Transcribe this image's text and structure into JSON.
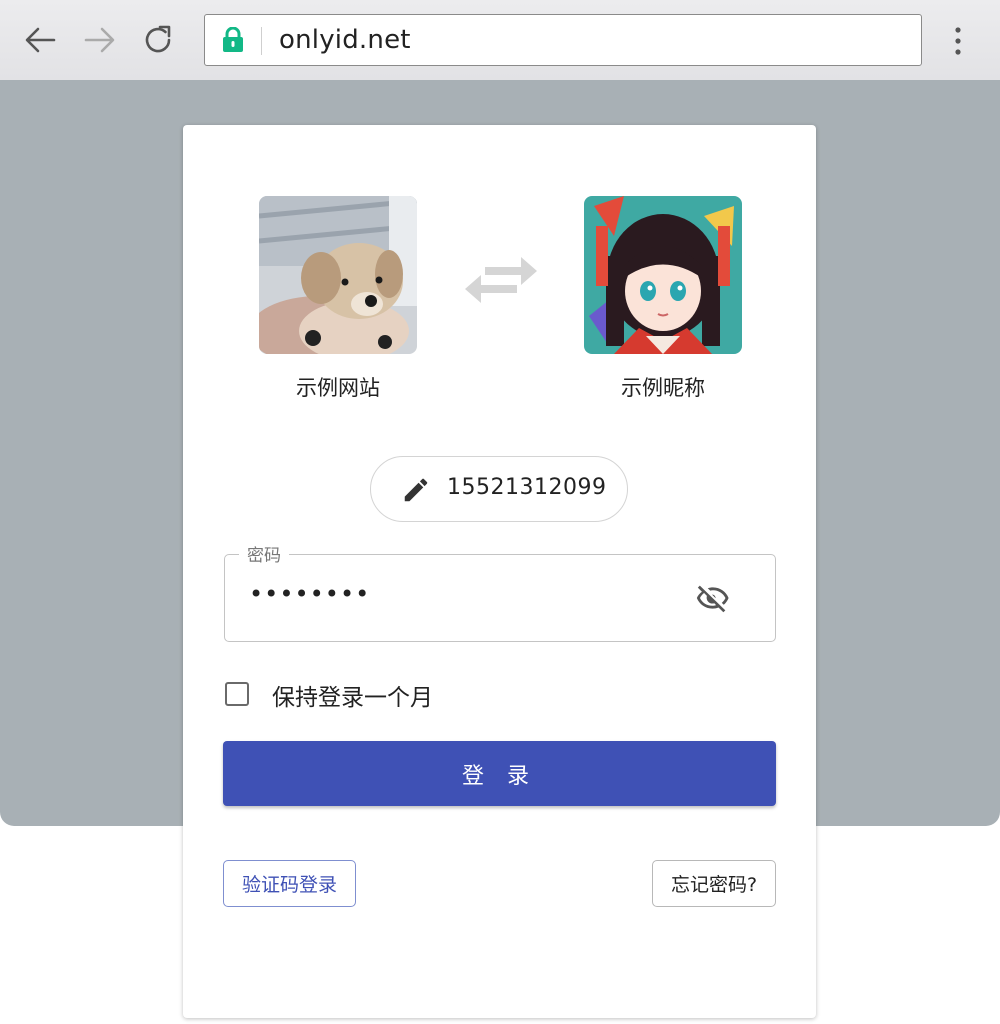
{
  "browser": {
    "url": "onlyid.net",
    "icons": [
      "back-arrow-icon",
      "forward-arrow-icon",
      "reload-icon",
      "lock-icon",
      "more-vert-icon"
    ]
  },
  "login": {
    "site": {
      "label": "示例网站",
      "icon": "dog-photo"
    },
    "user": {
      "label": "示例昵称",
      "icon": "anime-avatar"
    },
    "phone": "15521312099",
    "password": {
      "legend": "密码",
      "value": "••••••••"
    },
    "remember_label": "保持登录一个月",
    "login_button": "登 录",
    "sms_login": "验证码登录",
    "forgot_password": "忘记密码?"
  },
  "colors": {
    "accent": "#3f51b5",
    "lock_green": "#12b886",
    "page_bg": "#a8b0b5"
  }
}
